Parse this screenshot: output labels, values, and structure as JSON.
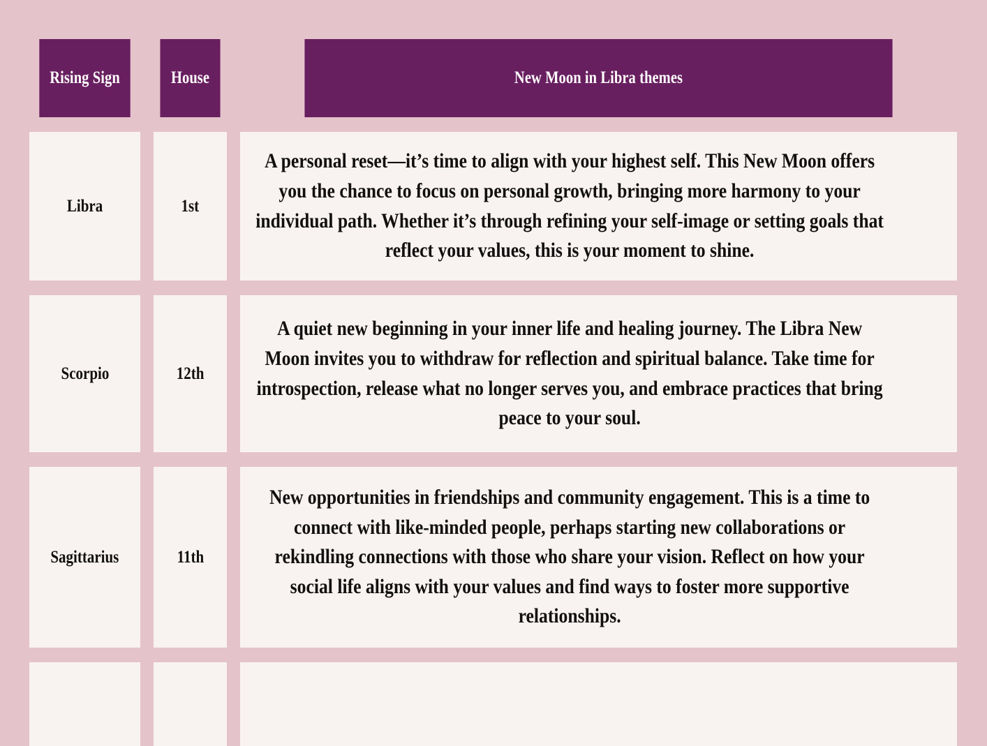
{
  "theme": {
    "page_background": "#e5c3cb",
    "header_background": "#681f60",
    "header_text_color": "#fdfbfa",
    "cell_background": "#f8f3f1",
    "cell_text_color": "#12100f"
  },
  "table": {
    "headers": {
      "rising_sign": "Rising Sign",
      "house": "House",
      "theme": "New Moon in Libra themes"
    },
    "rows": [
      {
        "sign": "Libra",
        "house": "1st",
        "theme": "A personal reset—it’s time to align with your highest self. This New Moon offers you the chance to focus on personal growth, bringing more harmony to your individual path. Whether it’s through refining your self-image or setting goals that reflect your values, this is your moment to shine."
      },
      {
        "sign": "Scorpio",
        "house": "12th",
        "theme": "A quiet new beginning in your inner life and healing journey. The Libra New Moon invites you to withdraw for reflection and spiritual balance. Take time for introspection, release what no longer serves you, and embrace practices that bring peace to your soul."
      },
      {
        "sign": "Sagittarius",
        "house": "11th",
        "theme": "New opportunities in friendships and community engagement. This is a time to connect with like-minded people, perhaps starting new collaborations or rekindling connections with those who share your vision. Reflect on how your social life aligns with your values and find ways to foster more supportive relationships."
      },
      {
        "sign": "",
        "house": "",
        "theme": ""
      }
    ]
  }
}
